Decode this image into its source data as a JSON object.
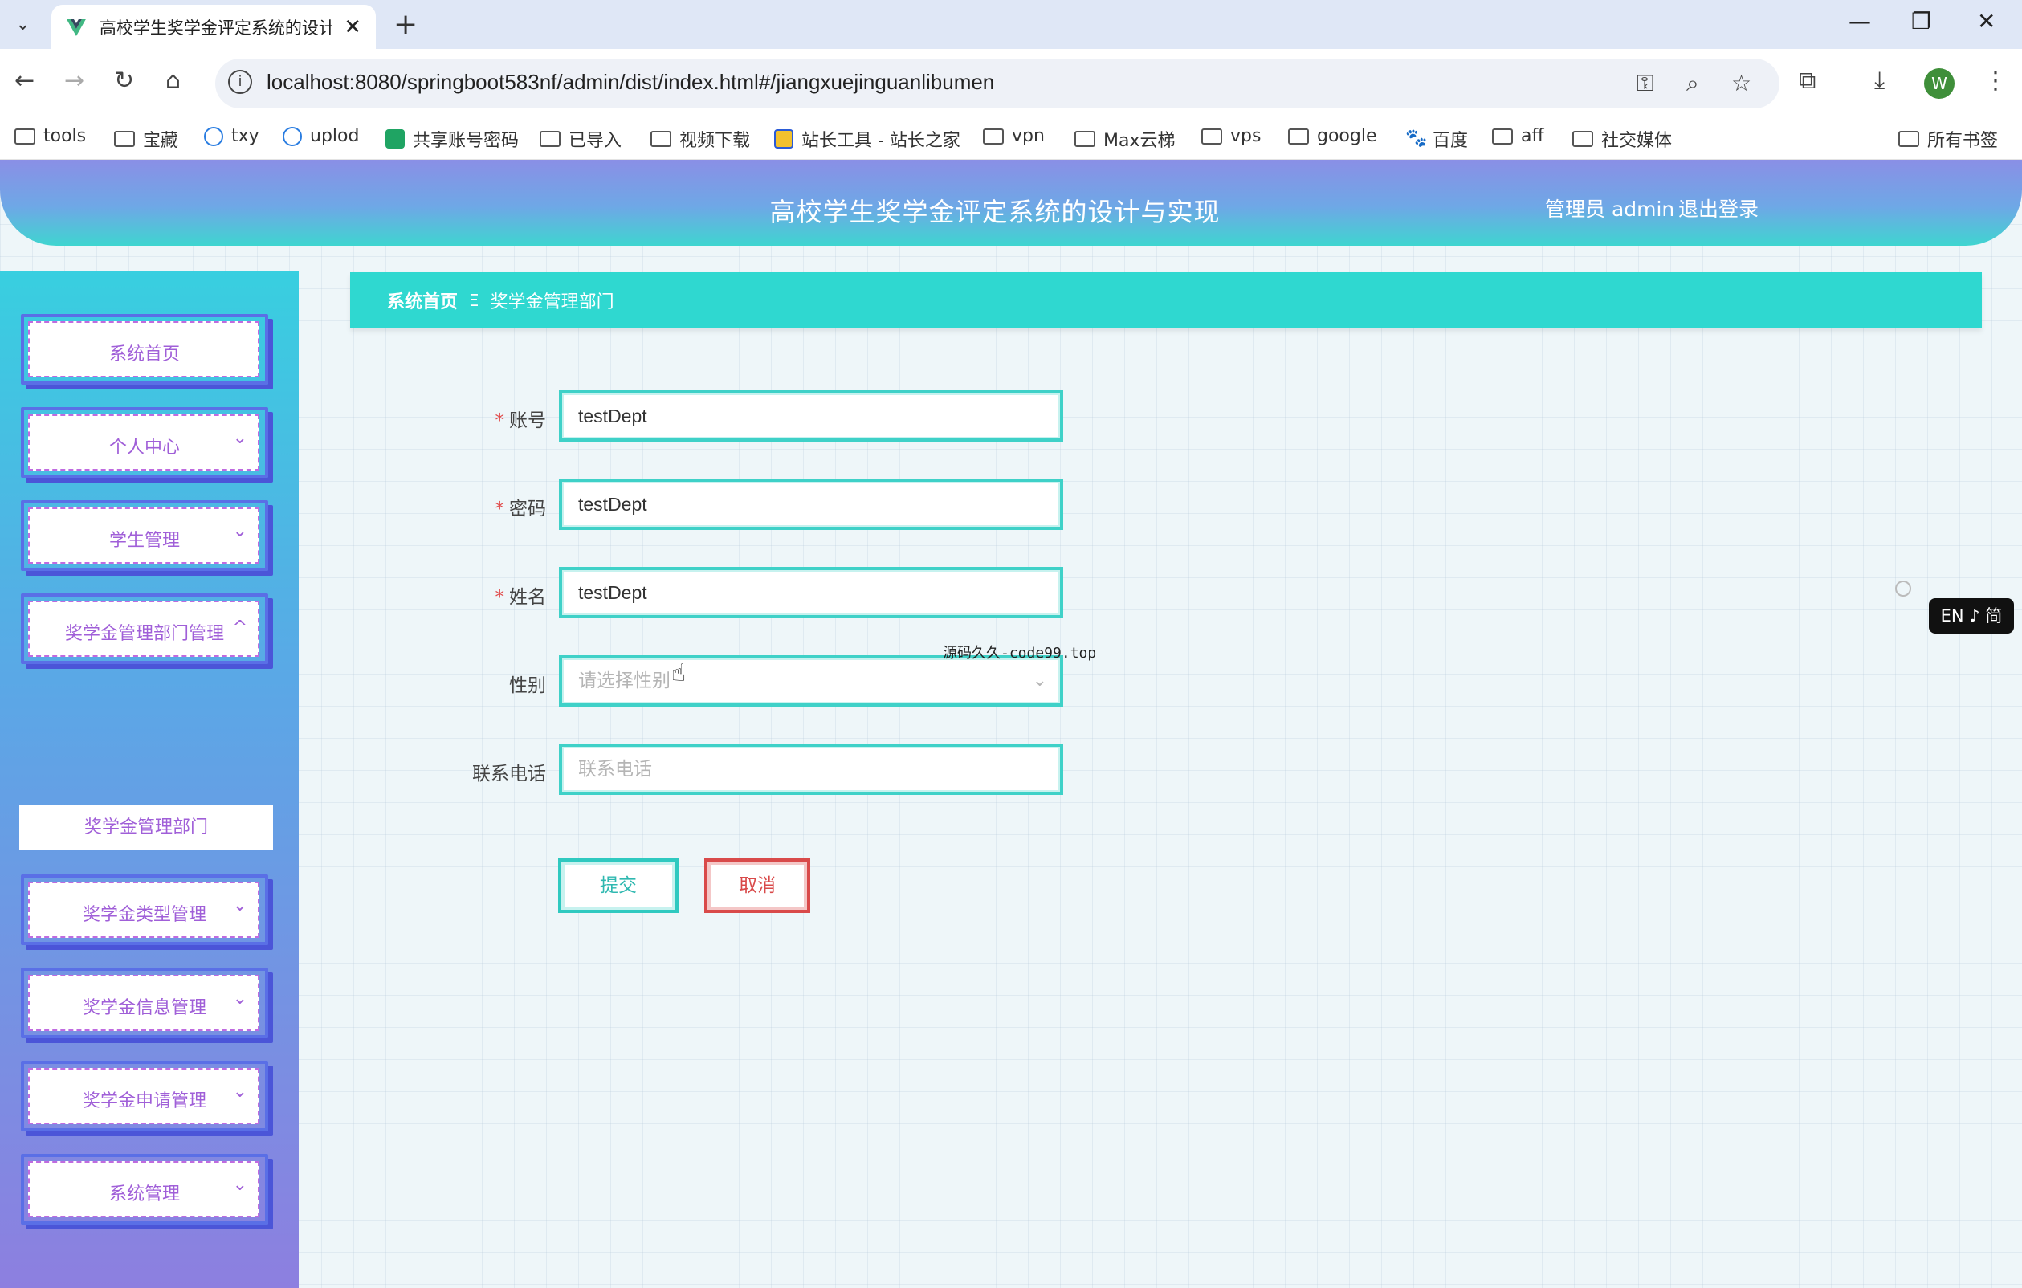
{
  "browser": {
    "tab_title": "高校学生奖学金评定系统的设计",
    "url": "localhost:8080/springboot583nf/admin/dist/index.html#/jiangxuejinguanlibumen",
    "profile_initial": "W",
    "bookmarks": [
      "tools",
      "宝藏",
      "txy",
      "uplod",
      "共享账号密码",
      "已导入",
      "视频下载",
      "站长工具 - 站长之家",
      "vpn",
      "Max云梯",
      "vps",
      "google",
      "百度",
      "aff",
      "社交媒体"
    ],
    "all_bookmarks": "所有书签"
  },
  "header": {
    "title": "高校学生奖学金评定系统的设计与实现",
    "user": "管理员 admin",
    "logout": "退出登录"
  },
  "sidebar": {
    "items": [
      {
        "label": "系统首页"
      },
      {
        "label": "个人中心"
      },
      {
        "label": "学生管理"
      },
      {
        "label": "奖学金管理部门管理"
      },
      {
        "label": "奖学金类型管理"
      },
      {
        "label": "奖学金信息管理"
      },
      {
        "label": "奖学金申请管理"
      },
      {
        "label": "系统管理"
      }
    ],
    "sub_item": "奖学金管理部门"
  },
  "breadcrumb": {
    "home": "系统首页",
    "separator": "Ξ",
    "current": "奖学金管理部门"
  },
  "form": {
    "account": {
      "label": "账号",
      "value": "testDept"
    },
    "password": {
      "label": "密码",
      "value": "testDept"
    },
    "name": {
      "label": "姓名",
      "value": "testDept"
    },
    "gender": {
      "label": "性别",
      "placeholder": "请选择性别"
    },
    "phone": {
      "label": "联系电话",
      "placeholder": "联系电话"
    },
    "required_mark": "*",
    "submit": "提交",
    "cancel": "取消"
  },
  "overlay_text": "源码久久-code99.top",
  "lang_badge": "EN ♪ 简",
  "colors": {
    "accent": "#2fd8d0",
    "menu_text": "#a05fd8",
    "cancel": "#d94a4a"
  }
}
